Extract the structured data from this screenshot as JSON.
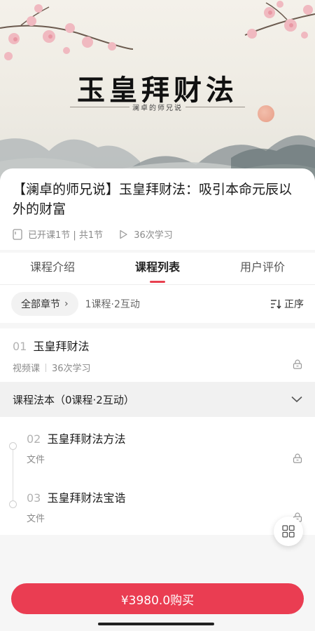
{
  "hero": {
    "title": "玉皇拜财法",
    "subtitle": "澜卓的师兄说"
  },
  "course": {
    "title": "【澜卓的师兄说】玉皇拜财法：吸引本命元辰以外的财富",
    "lessons_info": "已开课1节 | 共1节",
    "study_count": "36次学习"
  },
  "tabs": [
    {
      "label": "课程介绍"
    },
    {
      "label": "课程列表"
    },
    {
      "label": "用户评价"
    }
  ],
  "filter": {
    "chapter_button": "全部章节",
    "summary": "1课程·2互动",
    "sort_label": "正序"
  },
  "lesson_01": {
    "number": "01",
    "title": "玉皇拜财法",
    "type": "视频课",
    "study_count": "36次学习"
  },
  "section": {
    "title": "课程法本（0课程·2互动）"
  },
  "sub_lessons": [
    {
      "number": "02",
      "title": "玉皇拜财法方法",
      "type": "文件"
    },
    {
      "number": "03",
      "title": "玉皇拜财法宝诰",
      "type": "文件"
    }
  ],
  "buy_button": "¥3980.0购买",
  "colors": {
    "accent": "#e8404f",
    "buy": "#ea3d52"
  }
}
